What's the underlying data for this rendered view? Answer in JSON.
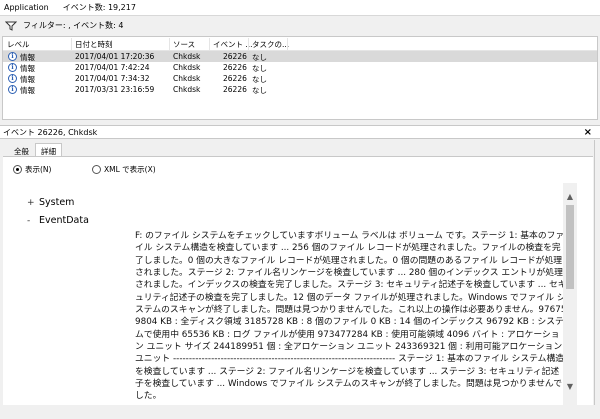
{
  "titlebar": {
    "app_name": "Application",
    "event_count": "イベント数: 19,217"
  },
  "filterbar": {
    "icon": "filter-icon",
    "text": "フィルター: , イベント数: 4"
  },
  "list": {
    "columns": [
      "レベル",
      "日付と時刻",
      "ソース",
      "イベント ...",
      "タスクの..."
    ],
    "rows": [
      {
        "level": "情報",
        "datetime": "2017/04/01 17:20:36",
        "source": "Chkdsk",
        "event_id": "26226",
        "task": "なし",
        "selected": true
      },
      {
        "level": "情報",
        "datetime": "2017/04/01 7:42:24",
        "source": "Chkdsk",
        "event_id": "26226",
        "task": "なし",
        "selected": false
      },
      {
        "level": "情報",
        "datetime": "2017/04/01 7:34:32",
        "source": "Chkdsk",
        "event_id": "26226",
        "task": "なし",
        "selected": false
      },
      {
        "level": "情報",
        "datetime": "2017/03/31 23:16:59",
        "source": "Chkdsk",
        "event_id": "26226",
        "task": "なし",
        "selected": false
      }
    ]
  },
  "detail": {
    "title": "イベント 26226, Chkdsk",
    "close_icon": "close-icon",
    "tabs": [
      {
        "label": "全般",
        "active": false
      },
      {
        "label": "詳細",
        "active": true
      }
    ],
    "view_options": [
      {
        "label": "表示(N)",
        "selected": true
      },
      {
        "label": "XML で表示(X)",
        "selected": false
      }
    ],
    "tree": [
      {
        "sign": "+",
        "label": "System"
      },
      {
        "sign": "-",
        "label": "EventData"
      }
    ],
    "event_text": "F: のファイル システムをチェックしていますボリューム ラベルは ボリューム です。ステージ 1: 基本のファイル システム構造を検査しています ... 256 個のファイル レコードが処理されました。ファイルの検査を完了しました。0 個の大きなファイル レコードが処理されました。0 個の問題のあるファイル レコードが処理されました。ステージ 2: ファイル名リンケージを検査しています ... 280 個のインデックス エントリが処理されました。インデックスの検査を完了しました。ステージ 3: セキュリティ記述子を検査しています ... セキュリティ記述子の検査を完了しました。12 個のデータ ファイルが処理されました。Windows でファイル システムのスキャンが終了しました。問題は見つかりませんでした。これ以上の操作は必要ありません。976759804 KB : 全ディスク領域 3185728 KB : 8 個のファイル 0 KB : 14 個のインデックス 96792 KB : システムで使用中 65536 KB : ログ ファイルが使用 973477284 KB : 使用可能領域 4096 バイト : アロケーション ユニット サイズ 244189951 個 : 全アロケーション ユニット 243369321 個 : 利用可能アロケーション ユニット ---------------------------------------------------------------------- ステージ 1: 基本のファイル システム構造を検査しています ... ステージ 2: ファイル名リンケージを検査しています ... ステージ 3: セキュリティ記述子を検査しています ... Windows でファイル システムのスキャンが終了しました。問題は見つかりませんでした。"
  },
  "scrollbar": {
    "up_icon": "scroll-up-icon",
    "down_icon": "scroll-down-icon"
  }
}
